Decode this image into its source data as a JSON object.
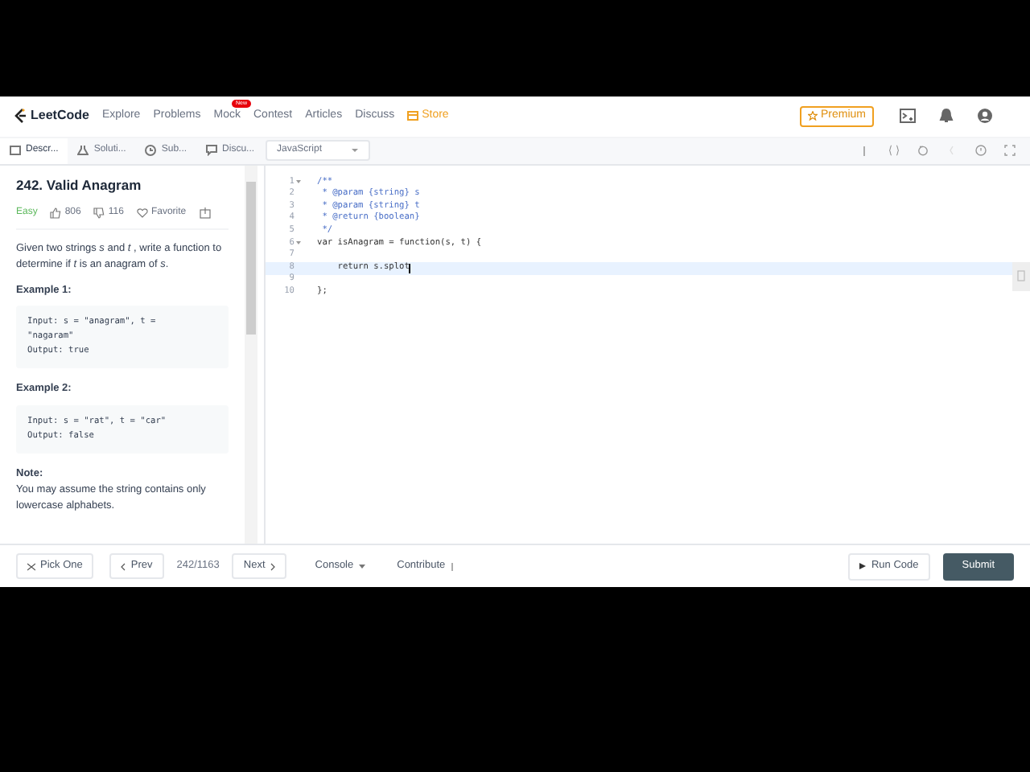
{
  "nav": {
    "logo": "LeetCode",
    "items": [
      {
        "label": "Explore",
        "kind": "link"
      },
      {
        "label": "Problems",
        "kind": "link"
      },
      {
        "label": "Mock",
        "kind": "link",
        "badge": "New"
      },
      {
        "label": "Contest",
        "kind": "link"
      },
      {
        "label": "Articles",
        "kind": "link"
      },
      {
        "label": "Discuss",
        "kind": "link"
      },
      {
        "label": "Store",
        "kind": "store"
      }
    ],
    "premium": "Premium"
  },
  "tabs": [
    {
      "label": "Descr...",
      "selected": true
    },
    {
      "label": "Soluti...",
      "selected": false
    },
    {
      "label": "Sub...",
      "selected": false
    },
    {
      "label": "Discu...",
      "selected": false
    }
  ],
  "language": "JavaScript",
  "problem": {
    "title": "242. Valid Anagram",
    "difficulty": "Easy",
    "likes": "806",
    "dislikes": "116",
    "favorite": "Favorite",
    "description": "Given two strings *s* and *t* , write a function to determine if *t* is an anagram of *s*.",
    "examples": [
      {
        "title": "Example 1:",
        "lines": [
          "Input: s = \"anagram\", t =",
          "\"nagaram\"",
          "Output: true"
        ]
      },
      {
        "title": "Example 2:",
        "lines": [
          "Input: s = \"rat\", t = \"car\"",
          "Output: false"
        ]
      }
    ],
    "note_title": "Note:",
    "note": "You may assume the string contains only lowercase alphabets."
  },
  "editor": {
    "lines": [
      {
        "number": "1",
        "text": "/**",
        "kind": "comment",
        "foldable": true,
        "current": false
      },
      {
        "number": "2",
        "text": " * @param {string} s",
        "kind": "comment",
        "foldable": false,
        "current": false
      },
      {
        "number": "3",
        "text": " * @param {string} t",
        "kind": "comment",
        "foldable": false,
        "current": false
      },
      {
        "number": "4",
        "text": " * @return {boolean}",
        "kind": "comment",
        "foldable": false,
        "current": false
      },
      {
        "number": "5",
        "text": " */",
        "kind": "comment",
        "foldable": false,
        "current": false
      },
      {
        "number": "6",
        "text": "var isAnagram = function(s, t) {",
        "kind": "code",
        "foldable": true,
        "current": false
      },
      {
        "number": "7",
        "kind": "code",
        "foldable": false,
        "current": false
      },
      {
        "number": "8",
        "text": "    return s.splot",
        "kind": "code",
        "foldable": false,
        "current": true
      },
      {
        "number": "9",
        "kind": "code",
        "foldable": false,
        "current": false
      },
      {
        "number": "10",
        "text": "};",
        "kind": "code",
        "foldable": false,
        "current": false
      }
    ]
  },
  "footer": {
    "pick_one": "Pick One",
    "prev": "Prev",
    "counter": "242/1163",
    "next": "Next",
    "console": "Console",
    "contribute": "Contribute",
    "run": "Run Code",
    "submit": "Submit"
  }
}
